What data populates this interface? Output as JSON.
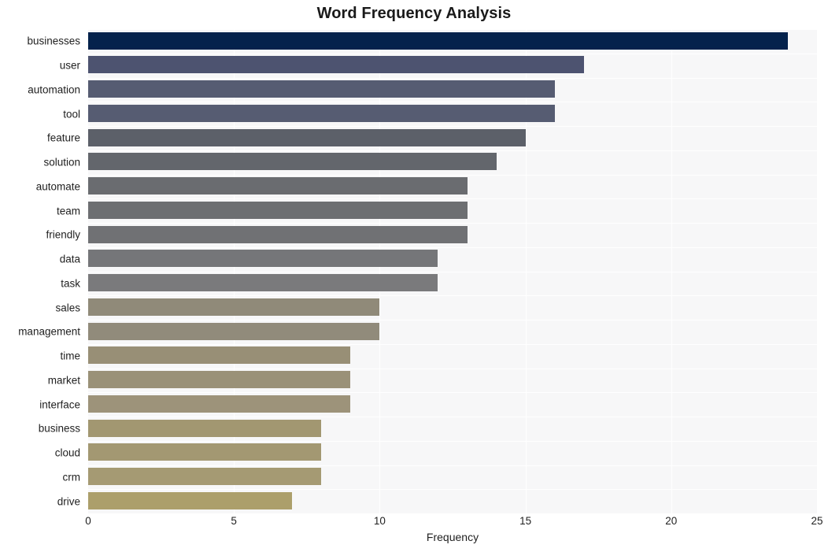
{
  "chart_data": {
    "type": "bar",
    "orientation": "horizontal",
    "title": "Word Frequency Analysis",
    "xlabel": "Frequency",
    "ylabel": "",
    "xlim": [
      0,
      25
    ],
    "xticks": [
      0,
      5,
      10,
      15,
      20,
      25
    ],
    "xtick_labels": [
      "0",
      "5",
      "10",
      "15",
      "20",
      "25"
    ],
    "grid": true,
    "grid_axis": "both",
    "legend": false,
    "plot_background": "#f7f7f8",
    "figure_background": "#ffffff",
    "gridline_color": "#ffffff",
    "text_color": "#1f1f1f",
    "categories": [
      "businesses",
      "user",
      "automation",
      "tool",
      "feature",
      "solution",
      "automate",
      "team",
      "friendly",
      "data",
      "task",
      "sales",
      "management",
      "time",
      "market",
      "interface",
      "business",
      "cloud",
      "crm",
      "drive"
    ],
    "values": [
      24,
      17,
      16,
      16,
      15,
      14,
      13,
      13,
      13,
      12,
      12,
      10,
      10,
      9,
      9,
      9,
      8,
      8,
      8,
      7
    ],
    "bar_colors": [
      "#04224c",
      "#4d5370",
      "#565c72",
      "#565c72",
      "#5c6069",
      "#63666c",
      "#6a6c70",
      "#6d6f72",
      "#707174",
      "#757679",
      "#7a7a7c",
      "#908a79",
      "#918b7b",
      "#988f76",
      "#9a9178",
      "#9d937a",
      "#a29771",
      "#a39872",
      "#a59a73",
      "#ac9f6b"
    ]
  }
}
